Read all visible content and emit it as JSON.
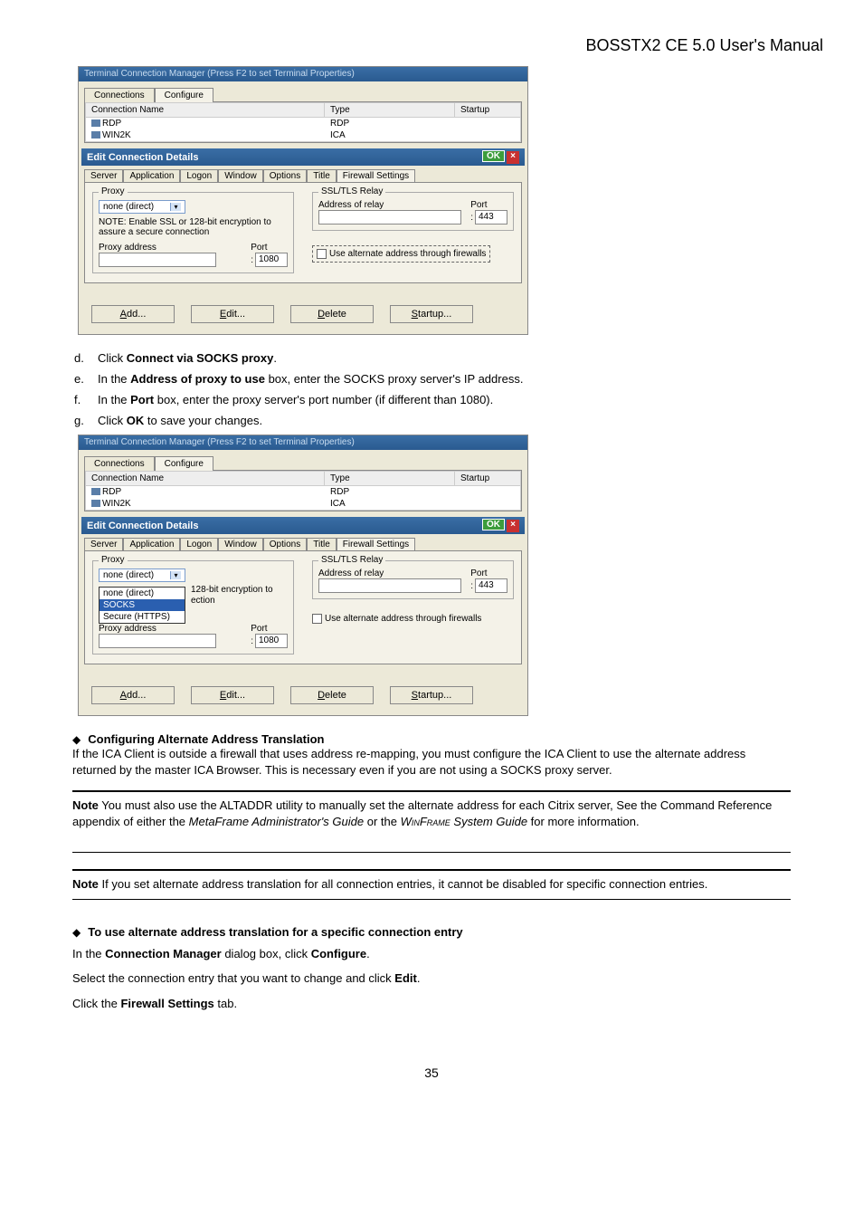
{
  "header": "BOSSTX2 CE 5.0 User's Manual",
  "shot": {
    "titlebar": "Terminal Connection Manager (Press F2 to set Terminal Properties)",
    "outerTabs": {
      "t1": "Connections",
      "t2": "Configure"
    },
    "cols": {
      "c1": "Connection Name",
      "c2": "Type",
      "c3": "Startup"
    },
    "rows": [
      {
        "name": "RDP",
        "type": "RDP"
      },
      {
        "name": "WIN2K",
        "type": "ICA"
      }
    ],
    "editTitle": "Edit Connection Details",
    "ok": "OK",
    "innerTabs": [
      "Server",
      "Application",
      "Logon",
      "Window",
      "Options",
      "Title",
      "Firewall Settings"
    ],
    "proxy": {
      "legend": "Proxy",
      "comboValue": "none (direct)",
      "note": "NOTE: Enable SSL or 128-bit encryption to assure a secure connection",
      "addrLabel": "Proxy address",
      "portLabel": "Port",
      "portValue": "1080",
      "dropdownOpts": [
        "none (direct)",
        "SOCKS",
        "Secure (HTTPS)"
      ],
      "dropRightNote1": "128-bit encryption to",
      "dropRightNote2": "ection"
    },
    "relay": {
      "legend": "SSL/TLS Relay",
      "addrLabel": "Address of relay",
      "portLabel": "Port",
      "portValue": "443",
      "altchk": "Use alternate address through firewalls"
    },
    "buttons": {
      "add": "Add...",
      "edit": "Edit...",
      "del": "Delete",
      "startup": "Startup..."
    }
  },
  "steps": {
    "d": {
      "pre": "Click ",
      "bold": "Connect via SOCKS proxy",
      "post": "."
    },
    "e": {
      "pre": "In the ",
      "bold": "Address of proxy to use",
      "post": " box, enter the SOCKS proxy server's IP address."
    },
    "f": {
      "pre": "In the ",
      "bold": "Port",
      "post": " box, enter the proxy server's port number (if different than 1080)."
    },
    "g": {
      "pre": "Click ",
      "bold": "OK",
      "post": " to save your changes."
    }
  },
  "sec1": {
    "title": "Configuring Alternate Address Translation",
    "body": "If the ICA Client is outside a firewall that uses address re-mapping, you must configure the ICA Client to use the alternate address returned by the master ICA Browser. This is necessary even if you are not using a SOCKS proxy server."
  },
  "note1": {
    "label": "Note",
    "t1": "  You must also use the ALTADDR utility to manually set the alternate address for each Citrix server, See the Command Reference appendix of either the ",
    "it1": "MetaFrame Administrator's Guide",
    "t2": " or the ",
    "it2": "WinFrame",
    "it3": " System Guide",
    "t3": " for more information."
  },
  "note2": {
    "label": "Note",
    "text": "  If you set alternate address translation for all connection entries, it cannot be disabled for specific connection entries."
  },
  "sec2": {
    "title": "To use alternate address translation for a specific connection entry",
    "p1a": "In the ",
    "p1b": "Connection Manager",
    "p1c": " dialog box, click ",
    "p1d": "Configure",
    "p1e": ".",
    "p2a": "Select the connection entry that you want to change and click ",
    "p2b": "Edit",
    "p2c": ".",
    "p3a": "Click the ",
    "p3b": "Firewall Settings",
    "p3c": " tab."
  },
  "pageNum": "35"
}
